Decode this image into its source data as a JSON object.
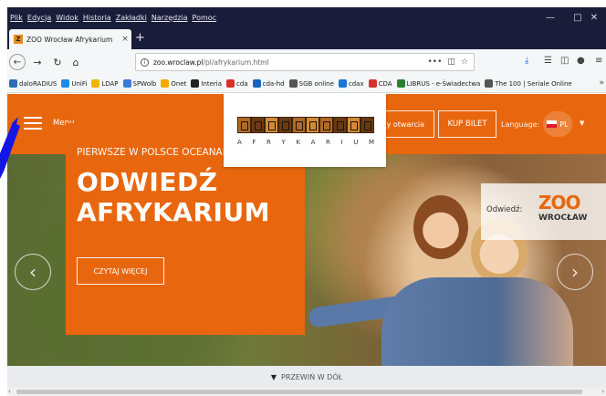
{
  "menubar": {
    "items": [
      "Plik",
      "Edycja",
      "Widok",
      "Historia",
      "Zakładki",
      "Narzędzia",
      "Pomoc"
    ]
  },
  "tab": {
    "title": "ZOO Wrocław Afrykarium",
    "close": "×",
    "new_tab": "+"
  },
  "navbar": {
    "url_domain": "zoo.wroclaw.pl",
    "url_path": "/pl/afrykarium.html",
    "more": "•••"
  },
  "bookmarks": [
    {
      "label": "daloRADIUS",
      "color": "#2b6fb3"
    },
    {
      "label": "UniFi",
      "color": "#1e88e5"
    },
    {
      "label": "LDAP",
      "color": "#f0b400"
    },
    {
      "label": "SPWolb",
      "color": "#3a7bd5"
    },
    {
      "label": "Onet",
      "color": "#f2a900"
    },
    {
      "label": "Interia",
      "color": "#222222"
    },
    {
      "label": "cda",
      "color": "#d9302b"
    },
    {
      "label": "cda-hd",
      "color": "#1565c0"
    },
    {
      "label": "SGB online",
      "color": "#555555"
    },
    {
      "label": "cdax",
      "color": "#1976d2"
    },
    {
      "label": "CDA",
      "color": "#d9302b"
    },
    {
      "label": "LIBRUS - e-Świadectwa",
      "color": "#2e7d32"
    },
    {
      "label": "The 100 | Seriale Online",
      "color": "#555555"
    }
  ],
  "site": {
    "menu_label": "Menu",
    "hours_button": "Godziny otwarcia",
    "ticket_button": "KUP BILET",
    "language_label": "Language:",
    "language_value": "PL",
    "logo_letters": [
      "A",
      "F",
      "R",
      "Y",
      "K",
      "A",
      "R",
      "I",
      "U",
      "M"
    ],
    "accent_color": "#e8670e"
  },
  "hero": {
    "kicker": "PIERWSZE W POLSCE OCEANARIUM",
    "headline_line1": "ODWIEDŹ",
    "headline_line2": "AFRYKARIUM",
    "read_more": "CZYTAJ WIĘCEJ",
    "visit_label": "Odwiedź:",
    "visit_logo_top": "ZOO",
    "visit_logo_bottom": "WROCŁAW",
    "prev_arrow": "‹",
    "next_arrow": "›"
  },
  "scroll_hint": "PRZEWIŃ W DÓŁ"
}
